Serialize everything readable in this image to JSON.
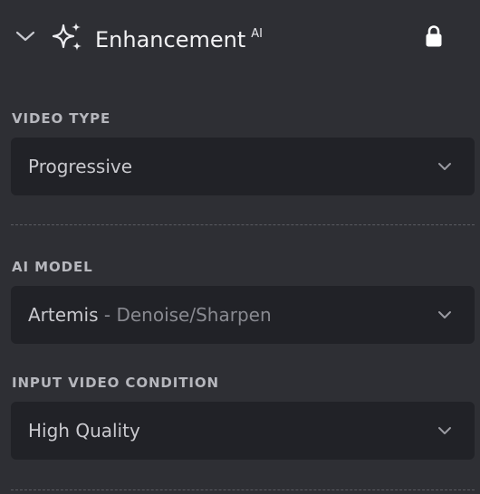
{
  "header": {
    "title": "Enhancement",
    "badge": "AI",
    "icons": {
      "collapse": "chevron-down-icon",
      "feature": "sparkles-icon",
      "lock": "lock-icon"
    }
  },
  "video_type": {
    "label": "VIDEO TYPE",
    "value": "Progressive"
  },
  "ai_model": {
    "label": "AI MODEL",
    "value": "Artemis",
    "separator": "-",
    "subtitle": "Denoise/Sharpen"
  },
  "input_condition": {
    "label": "INPUT VIDEO CONDITION",
    "value": "High Quality"
  },
  "colors": {
    "background": "#2e2f34",
    "field": "#212227",
    "label": "#b6b7bd",
    "text": "#f2f2f4"
  }
}
